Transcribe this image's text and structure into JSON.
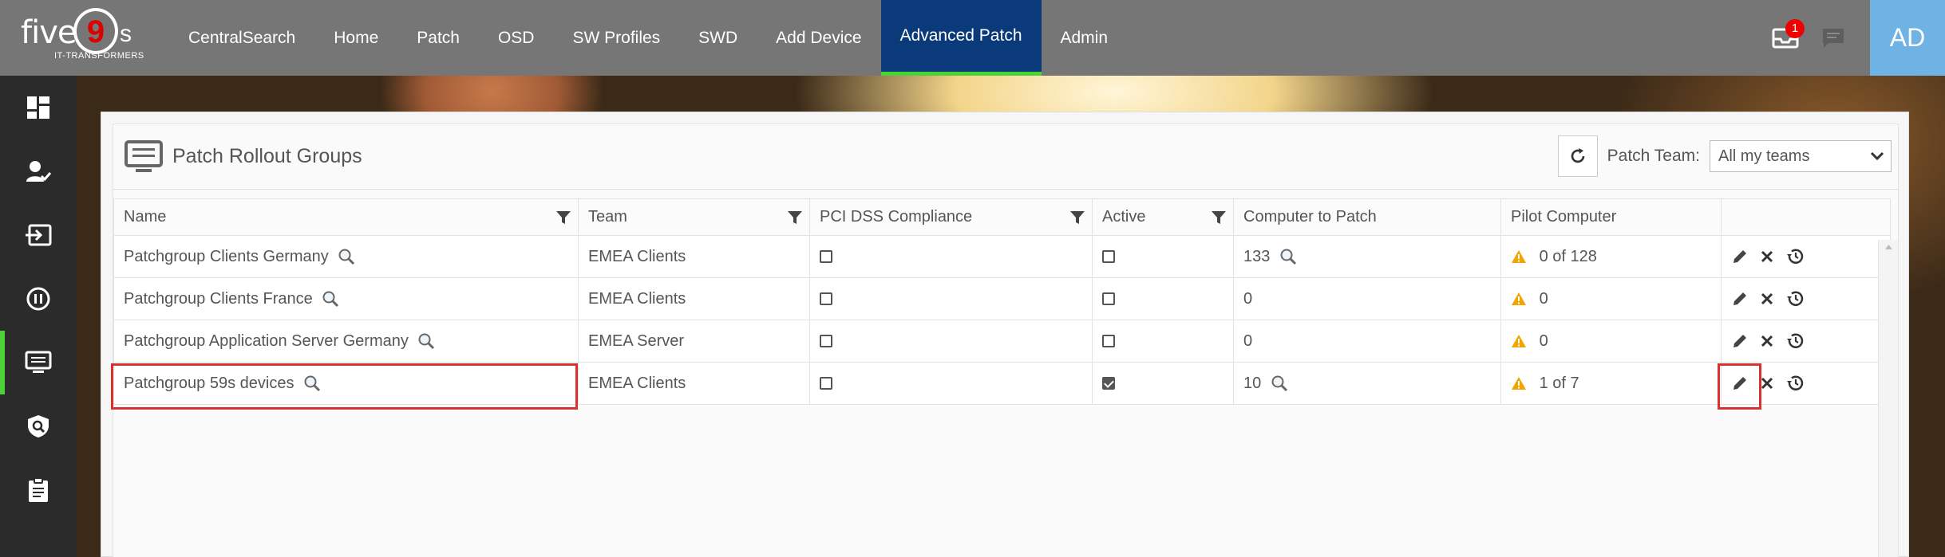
{
  "brand": {
    "word": "five",
    "nine": "9",
    "s": "s",
    "tagline": "IT-TRANSFORMERS"
  },
  "nav": {
    "items": [
      {
        "label": "CentralSearch"
      },
      {
        "label": "Home"
      },
      {
        "label": "Patch"
      },
      {
        "label": "OSD"
      },
      {
        "label": "SW Profiles"
      },
      {
        "label": "SWD"
      },
      {
        "label": "Add Device"
      },
      {
        "label": "Advanced Patch",
        "active": true
      },
      {
        "label": "Admin"
      }
    ]
  },
  "header_right": {
    "notification_count": "1",
    "avatar_initials": "AD"
  },
  "sidebar": {
    "icons": [
      "dashboard-icon",
      "user-check-icon",
      "sign-in-icon",
      "pause-circle-icon",
      "monitor-list-icon",
      "shield-search-icon",
      "clipboard-icon"
    ],
    "active_index": 4
  },
  "panel": {
    "title": "Patch Rollout Groups",
    "team_label": "Patch Team:",
    "team_selected": "All my teams"
  },
  "table": {
    "columns": [
      "Name",
      "Team",
      "PCI DSS Compliance",
      "Active",
      "Computer to Patch",
      "Pilot Computer"
    ],
    "rows": [
      {
        "name": "Patchgroup Clients Germany",
        "team": "EMEA Clients",
        "pci": false,
        "active": false,
        "computers": "133",
        "computers_search": true,
        "pilot": "0 of 128"
      },
      {
        "name": "Patchgroup Clients France",
        "team": "EMEA Clients",
        "pci": false,
        "active": false,
        "computers": "0",
        "computers_search": false,
        "pilot": "0"
      },
      {
        "name": "Patchgroup Application Server Germany",
        "team": "EMEA Server",
        "pci": false,
        "active": false,
        "computers": "0",
        "computers_search": false,
        "pilot": "0"
      },
      {
        "name": "Patchgroup 59s devices",
        "team": "EMEA Clients",
        "pci": false,
        "active": true,
        "computers": "10",
        "computers_search": true,
        "pilot": "1 of 7"
      }
    ]
  },
  "colors": {
    "topbar": "#767676",
    "nav_active": "#0a3a7a",
    "accent_green": "#4cd137",
    "avatar": "#6fb3e4",
    "sidebar": "#2b2b2b",
    "highlight": "#d93030",
    "warning": "#f0a500"
  }
}
